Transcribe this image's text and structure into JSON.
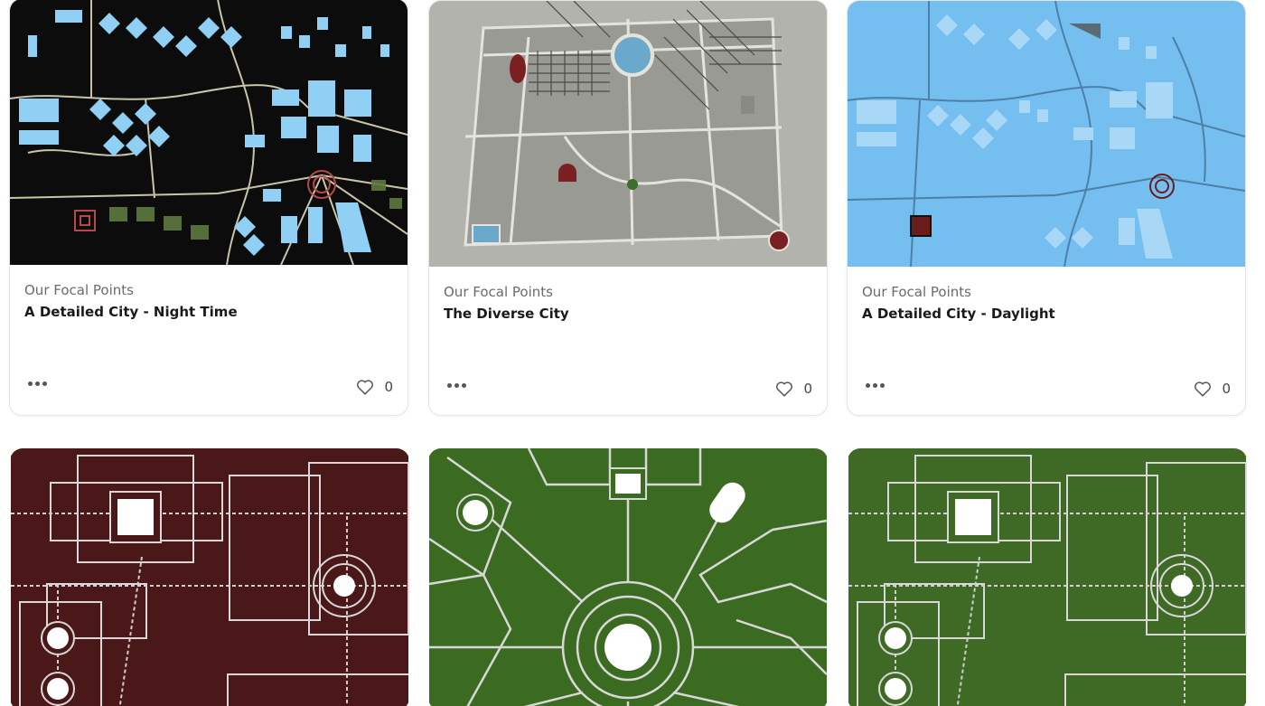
{
  "cards": [
    {
      "category": "Our Focal Points",
      "title": "A Detailed City - Night Time",
      "likes": "0",
      "palette": {
        "bg": "#0c0c0c",
        "fill": "#8fd0f4",
        "road": "#c9c4a8",
        "accent": "#b54848"
      }
    },
    {
      "category": "Our Focal Points",
      "title": "The Diverse City",
      "likes": "0",
      "palette": {
        "bg": "#b3b3ad",
        "fill": "#9a9a94",
        "road": "#e4e4dc",
        "accent": "#7a1f22",
        "pool": "#6aa8cc"
      }
    },
    {
      "category": "Our Focal Points",
      "title": "A Detailed City - Daylight",
      "likes": "0",
      "palette": {
        "bg": "#74bef0",
        "fill": "#a9d8f7",
        "road": "#4d7fa7",
        "accent": "#6b1c1c"
      }
    },
    {
      "palette": {
        "bg": "#4a1818",
        "line": "#d8d8d8",
        "node": "#ffffff"
      }
    },
    {
      "palette": {
        "bg": "#3b6b21",
        "line": "#d8d8d8",
        "node": "#ffffff"
      }
    },
    {
      "palette": {
        "bg": "#3f6a25",
        "line": "#d8d8d8",
        "node": "#ffffff"
      }
    }
  ],
  "icons": {
    "more": "more-horizontal-icon",
    "like": "heart-outline-icon"
  }
}
